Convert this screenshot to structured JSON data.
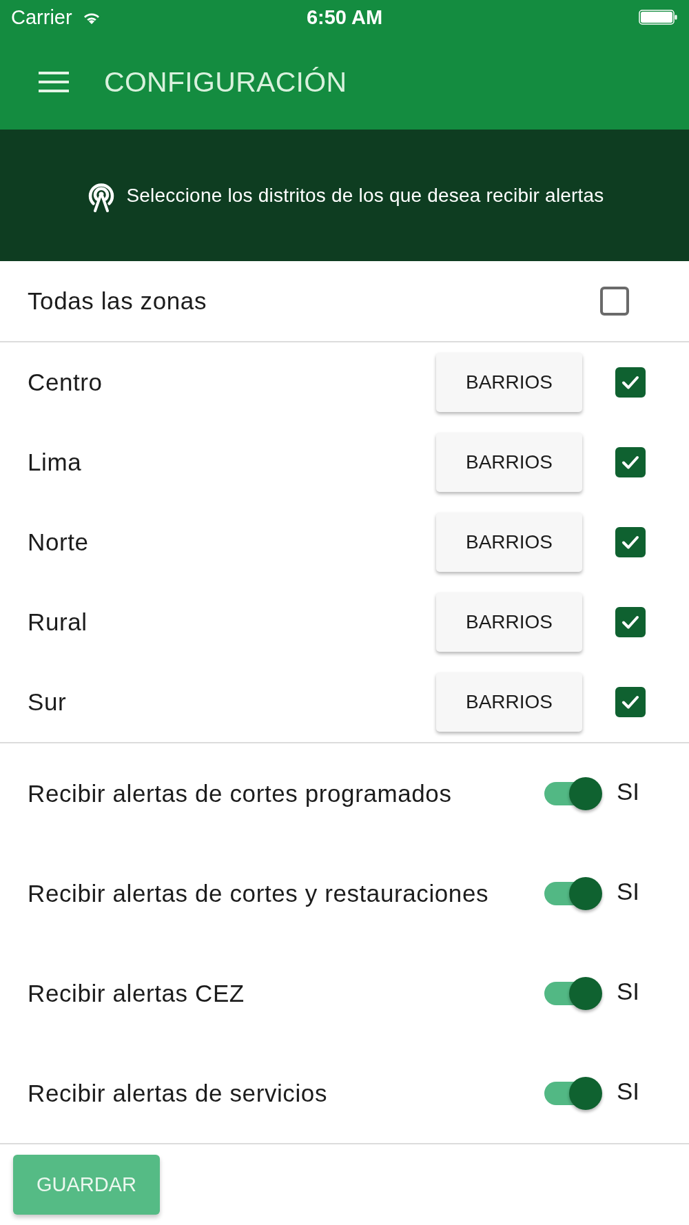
{
  "status_bar": {
    "carrier": "Carrier",
    "time": "6:50 AM"
  },
  "app_bar": {
    "title": "CONFIGURACIÓN"
  },
  "banner": {
    "text": "Seleccione los distritos de los que desea recibir alertas"
  },
  "all_zones": {
    "label": "Todas las zonas",
    "checked": false
  },
  "districts": [
    {
      "name": "Centro",
      "button": "BARRIOS",
      "checked": true
    },
    {
      "name": "Lima",
      "button": "BARRIOS",
      "checked": true
    },
    {
      "name": "Norte",
      "button": "BARRIOS",
      "checked": true
    },
    {
      "name": "Rural",
      "button": "BARRIOS",
      "checked": true
    },
    {
      "name": "Sur",
      "button": "BARRIOS",
      "checked": true
    }
  ],
  "alert_settings": [
    {
      "label": "Recibir alertas de cortes programados",
      "on": true,
      "state_label": "SI"
    },
    {
      "label": "Recibir alertas de cortes y restauraciones",
      "on": true,
      "state_label": "SI"
    },
    {
      "label": "Recibir alertas CEZ",
      "on": true,
      "state_label": "SI"
    },
    {
      "label": "Recibir alertas de servicios",
      "on": true,
      "state_label": "SI"
    }
  ],
  "save_button": {
    "label": "GUARDAR"
  }
}
